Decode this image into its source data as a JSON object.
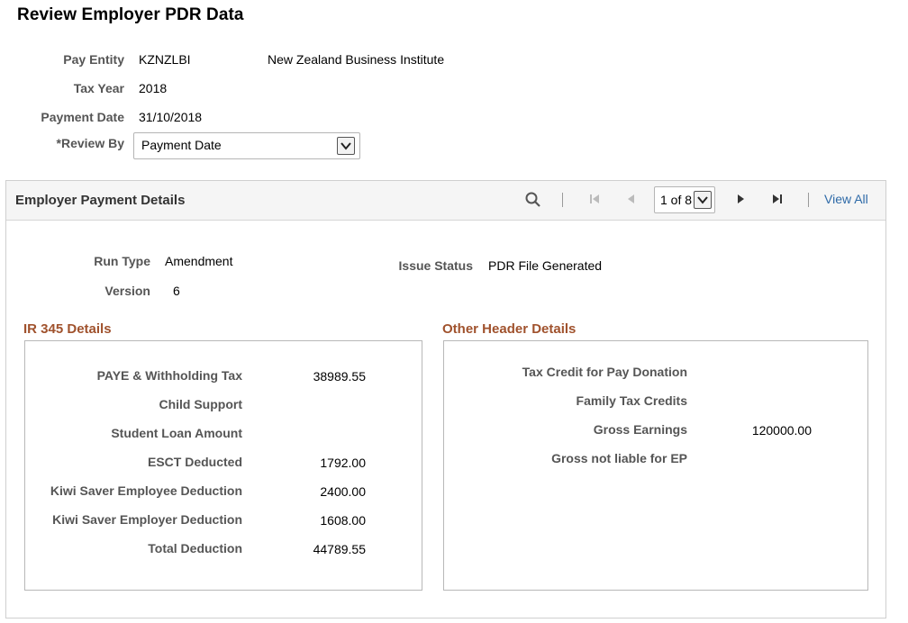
{
  "page": {
    "title": "Review Employer PDR Data"
  },
  "header": {
    "pay_entity_label": "Pay Entity",
    "pay_entity_code": "KZNZLBI",
    "pay_entity_name": "New Zealand Business Institute",
    "tax_year_label": "Tax Year",
    "tax_year_value": "2018",
    "payment_date_label": "Payment Date",
    "payment_date_value": "31/10/2018",
    "review_by_label": "*Review By",
    "review_by_value": "Payment Date"
  },
  "panel": {
    "title": "Employer Payment Details",
    "pager_value": "1 of 8",
    "view_all": "View All",
    "run_type_label": "Run Type",
    "run_type_value": "Amendment",
    "version_label": "Version",
    "version_value": "6",
    "issue_status_label": "Issue Status",
    "issue_status_value": "PDR File Generated"
  },
  "ir345": {
    "title": "IR 345 Details",
    "rows": [
      {
        "label": "PAYE & Withholding Tax",
        "value": "38989.55"
      },
      {
        "label": "Child Support",
        "value": ""
      },
      {
        "label": "Student Loan Amount",
        "value": ""
      },
      {
        "label": "ESCT Deducted",
        "value": "1792.00"
      },
      {
        "label": "Kiwi Saver Employee Deduction",
        "value": "2400.00"
      },
      {
        "label": "Kiwi Saver Employer Deduction",
        "value": "1608.00"
      },
      {
        "label": "Total Deduction",
        "value": "44789.55"
      }
    ]
  },
  "other": {
    "title": "Other Header Details",
    "rows": [
      {
        "label": "Tax Credit for Pay Donation",
        "value": ""
      },
      {
        "label": "Family Tax Credits",
        "value": ""
      },
      {
        "label": "Gross Earnings",
        "value": "120000.00"
      },
      {
        "label": "Gross not liable for EP",
        "value": ""
      }
    ]
  },
  "colors": {
    "link": "#2e6aa8",
    "group_title": "#a0522d",
    "label": "#555555"
  },
  "icons": [
    "search-icon",
    "first-page-icon",
    "previous-icon",
    "next-icon",
    "last-page-icon",
    "chevron-down-icon"
  ]
}
